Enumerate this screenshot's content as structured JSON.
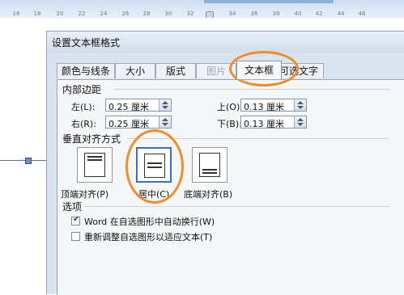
{
  "ruler": {
    "tick_labels": [
      "16",
      "18",
      "20",
      "22",
      "24",
      "26",
      "28",
      "30",
      "32",
      "34",
      "36",
      "38",
      "40",
      "42",
      "44",
      "46"
    ]
  },
  "dialog": {
    "title": "设置文本框格式",
    "tabs": [
      {
        "label": "颜色与线条",
        "state": "normal"
      },
      {
        "label": "大小",
        "state": "normal"
      },
      {
        "label": "版式",
        "state": "normal"
      },
      {
        "label": "图片",
        "state": "disabled"
      },
      {
        "label": "文本框",
        "state": "active"
      },
      {
        "label": "可选文字",
        "state": "normal"
      }
    ],
    "internal_margin": {
      "section_label": "内部边距",
      "left": {
        "label": "左(L):",
        "value": "0.25 厘米"
      },
      "right": {
        "label": "右(R):",
        "value": "0.25 厘米"
      },
      "top": {
        "label": "上(O):",
        "value": "0.13 厘米"
      },
      "bottom": {
        "label": "下(B):",
        "value": "0.13 厘米"
      }
    },
    "vertical_alignment": {
      "section_label": "垂直对齐方式",
      "options": [
        {
          "label": "顶端对齐(P)",
          "selected": false
        },
        {
          "label": "居中(C)",
          "selected": true
        },
        {
          "label": "底端对齐(B)",
          "selected": false
        }
      ]
    },
    "options": {
      "section_label": "选项",
      "word_wrap": {
        "label": "Word 在自选图形中自动换行(W)",
        "checked": true
      },
      "resize_shape": {
        "label": "重新调整自选图形以适应文本(T)",
        "checked": false
      }
    }
  },
  "colors": {
    "annotation": "#f28c28",
    "selection": "#3a6fc8"
  }
}
